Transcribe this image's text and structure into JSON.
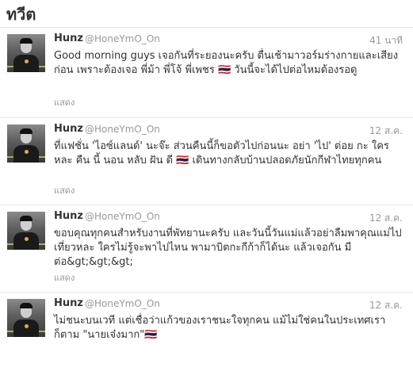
{
  "header": {
    "title": "ทวีต"
  },
  "tweets": [
    {
      "name": "Hunz",
      "handle": "@HoneYmO_On",
      "time": "41 นาที",
      "text": "Good morning guys เจอกันที่ระยองนะครับ ตื่นเช้ามาวอร์มร่างกายและเสียงก่อน เพราะต้องเจอ พี่ม้า พี่โจ้ พี่เพชร 🇹🇭 วันนี้จะได้ไปต่อไหมต้องรอดู",
      "expand": "แสดง"
    },
    {
      "name": "Hunz",
      "handle": "@HoneYmO_On",
      "time": "12 ส.ค.",
      "text": "ที่แฟชั่น 'ไอซ์แลนด์' นะจ๊ะ ส่วนคืนนี้ก็ขอตัวไปก่อนนะ อย่า 'ไป' ต่อย กะ ใคร หละ คืน นี้ นอน หลับ ฝัน ดี 🇹🇭 เดินทางกลับบ้านปลอดภัยนักกีฬาไทยทุกคน",
      "expand": "แสดง"
    },
    {
      "name": "Hunz",
      "handle": "@HoneYmO_On",
      "time": "12 ส.ค.",
      "text": "ขอบคุณทุกคนสำหรับงานที่พัทยานะครับ และวันนี้วันแม่แล้วอย่าลืมพาคุณแม่ไปเที่ยวหละ ใครไม่รู้จะพาไปไหน พามาบิตกะกีก้าก็ได้นะ แล้วเจอกัน มีต่อ&gt;&gt;&gt;",
      "expand": "แสดง"
    },
    {
      "name": "Hunz",
      "handle": "@HoneYmO_On",
      "time": "12 ส.ค.",
      "text": "ไม่ชนะบนเวที แต่เชื่อว่าแก้วของเราชนะใจทุกคน แม้ไม่ใช่คนในประเทศเราก็ตาม \"นายเจ๋งมาก\"🇹🇭",
      "expand": ""
    }
  ]
}
